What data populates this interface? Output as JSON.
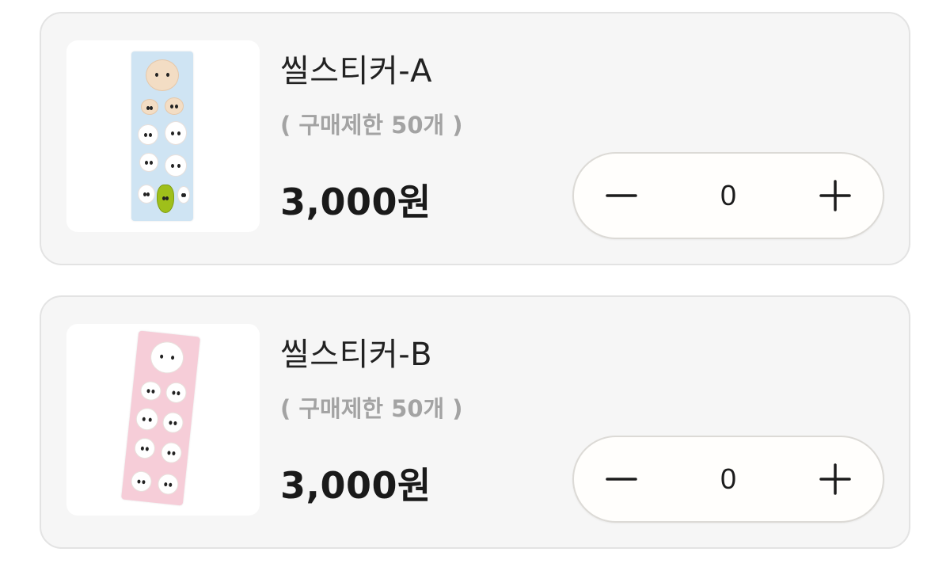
{
  "products": [
    {
      "name": "씰스티커-A",
      "limit": "( 구매제한 50개 )",
      "price": "3,000원",
      "quantity": "0",
      "thumbnail_color": "#cfe4f3"
    },
    {
      "name": "씰스티커-B",
      "limit": "( 구매제한 50개 )",
      "price": "3,000원",
      "quantity": "0",
      "thumbnail_color": "#f6cdd8"
    }
  ],
  "icons": {
    "decrement": "minus-icon",
    "increment": "plus-icon"
  }
}
